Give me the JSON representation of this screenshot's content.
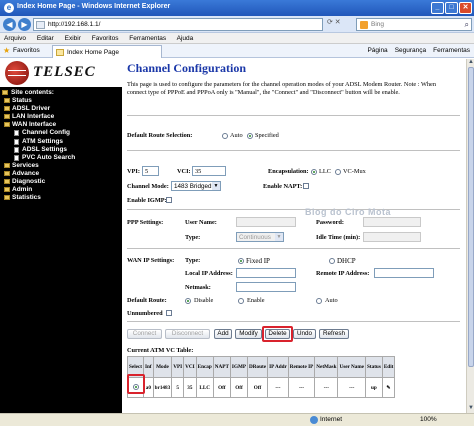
{
  "window": {
    "title": "Index Home Page - Windows Internet Explorer"
  },
  "address": {
    "url": "http://192.168.1.1/",
    "search_placeholder": "Bing"
  },
  "menu": [
    "Arquivo",
    "Editar",
    "Exibir",
    "Favoritos",
    "Ferramentas",
    "Ajuda"
  ],
  "favbar": {
    "favorites_label": "Favoritos",
    "tab_title": "Index Home Page",
    "tools": [
      "Página",
      "Segurança",
      "Ferramentas"
    ]
  },
  "sidebar": {
    "logo_text": "TELSEC",
    "items": [
      {
        "label": "Site contents:",
        "level": 0,
        "kind": "folder"
      },
      {
        "label": "Status",
        "level": 1,
        "kind": "folder"
      },
      {
        "label": "ADSL Driver",
        "level": 1,
        "kind": "folder"
      },
      {
        "label": "LAN Interface",
        "level": 1,
        "kind": "folder"
      },
      {
        "label": "WAN Interface",
        "level": 1,
        "kind": "folder"
      },
      {
        "label": "Channel Config",
        "level": 2,
        "kind": "page"
      },
      {
        "label": "ATM Settings",
        "level": 2,
        "kind": "page"
      },
      {
        "label": "ADSL Settings",
        "level": 2,
        "kind": "page"
      },
      {
        "label": "PVC Auto Search",
        "level": 2,
        "kind": "page"
      },
      {
        "label": "Services",
        "level": 1,
        "kind": "folder"
      },
      {
        "label": "Advance",
        "level": 1,
        "kind": "folder"
      },
      {
        "label": "Diagnostic",
        "level": 1,
        "kind": "folder"
      },
      {
        "label": "Admin",
        "level": 1,
        "kind": "folder"
      },
      {
        "label": "Statistics",
        "level": 1,
        "kind": "folder"
      }
    ]
  },
  "page": {
    "title": "Channel Configuration",
    "description": "This page is used to configure the parameters for the channel operation modes of your ADSL Modem Router. Note : When connect type of PPPoE and PPPoA only is \"Manual\", the \"Connect\" and \"Disconnect\" button will be enable.",
    "default_route": {
      "label": "Default Route Selection:",
      "options": [
        "Auto",
        "Specified"
      ],
      "selected": "Specified"
    },
    "vpi": {
      "label": "VPI:",
      "value": "5"
    },
    "vci": {
      "label": "VCI:",
      "value": "35"
    },
    "encap": {
      "label": "Encapsulation:",
      "options": [
        "LLC",
        "VC-Mux"
      ],
      "selected": "LLC"
    },
    "channel_mode": {
      "label": "Channel Mode:",
      "value": "1483 Bridged"
    },
    "enable_napt": {
      "label": "Enable NAPT:"
    },
    "enable_igmp": {
      "label": "Enable IGMP:"
    },
    "ppp": {
      "label": "PPP Settings:",
      "user_name": "User Name:",
      "password": "Password:",
      "type": "Type:",
      "type_value": "Continuous",
      "idle_time": "Idle Time (min):"
    },
    "wan_ip": {
      "label": "WAN IP Settings:",
      "type": "Type:",
      "options": [
        "Fixed IP",
        "DHCP"
      ],
      "selected": "Fixed IP",
      "local_ip": "Local IP Address:",
      "remote_ip": "Remote IP Address:",
      "netmask": "Netmask:",
      "default_route": "Default Route:",
      "route_options": [
        "Disable",
        "Enable",
        "Auto"
      ],
      "route_selected": "Disable",
      "unnumbered": "Unnumbered"
    },
    "buttons": {
      "connect": "Connect",
      "disconnect": "Disconnect",
      "add": "Add",
      "modify": "Modify",
      "delete": "Delete",
      "undo": "Undo",
      "refresh": "Refresh"
    },
    "watermark": "Blog do Ciro Mota",
    "table": {
      "title": "Current ATM VC Table:",
      "headers": [
        "Select",
        "Inf",
        "Mode",
        "VPI",
        "VCI",
        "Encap",
        "NAPT",
        "IGMP",
        "DRoute",
        "IP Addr",
        "Remote IP",
        "NetMask",
        "User Name",
        "Status",
        "Edit"
      ],
      "rows": [
        {
          "inf": "a0",
          "mode": "br1483",
          "vpi": "5",
          "vci": "35",
          "encap": "LLC",
          "napt": "Off",
          "igmp": "Off",
          "droute": "Off",
          "ip": "---",
          "remote": "---",
          "netmask": "---",
          "user": "---",
          "status": "up"
        }
      ]
    }
  },
  "statusbar": {
    "zone": "Internet",
    "zoom": "100%"
  }
}
